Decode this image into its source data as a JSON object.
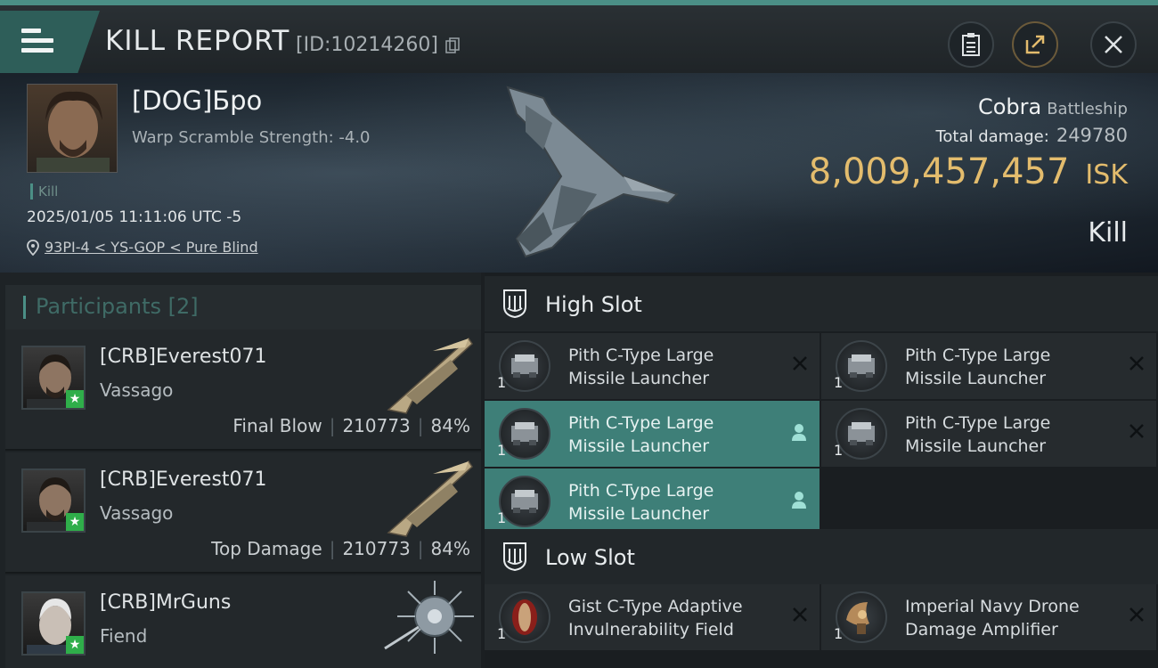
{
  "header": {
    "title": "KILL REPORT",
    "report_id": "[ID:10214260]",
    "buttons": [
      "clipboard",
      "share",
      "close"
    ]
  },
  "victim": {
    "name": "[DOG]Бро",
    "warp_scramble": "Warp Scramble Strength: -4.0",
    "tag": "Kill",
    "datetime": "2025/01/05 11:11:06 UTC -5",
    "location": "93PI-4 < YS-GOP < Pure Blind",
    "ship_name": "Cobra",
    "ship_class": "Battleship",
    "total_damage_label": "Total damage:",
    "total_damage": "249780",
    "isk_value": "8,009,457,457",
    "isk_unit": "ISK",
    "result": "Kill"
  },
  "participants": {
    "header": "Participants [2]",
    "rows": [
      {
        "name": "[CRB]Everest071",
        "ship": "Vassago",
        "role": "Final Blow",
        "damage": "210773",
        "percent": "84%"
      },
      {
        "name": "[CRB]Everest071",
        "ship": "Vassago",
        "role": "Top Damage",
        "damage": "210773",
        "percent": "84%"
      },
      {
        "name": "[CRB]MrGuns",
        "ship": "Fiend",
        "role": "",
        "damage": "",
        "percent": ""
      }
    ]
  },
  "slots": {
    "high": {
      "label": "High Slot",
      "modules": [
        {
          "name": "Pith C-Type Large Missile Launcher",
          "qty": "1",
          "state": "destroyed"
        },
        {
          "name": "Pith C-Type Large Missile Launcher",
          "qty": "1",
          "state": "destroyed"
        },
        {
          "name": "Pith C-Type Large Missile Launcher",
          "qty": "1",
          "state": "dropped"
        },
        {
          "name": "Pith C-Type Large Missile Launcher",
          "qty": "1",
          "state": "destroyed"
        },
        {
          "name": "Pith C-Type Large Missile Launcher",
          "qty": "1",
          "state": "dropped"
        }
      ]
    },
    "low": {
      "label": "Low Slot",
      "modules": [
        {
          "name": "Gist C-Type Adaptive Invulnerability Field",
          "qty": "1",
          "state": "destroyed"
        },
        {
          "name": "Imperial Navy Drone Damage Amplifier",
          "qty": "1",
          "state": "destroyed"
        }
      ]
    }
  },
  "colors": {
    "accent": "#4b8f86",
    "isk": "#e3bc6d",
    "active_module": "#3e7f78"
  }
}
